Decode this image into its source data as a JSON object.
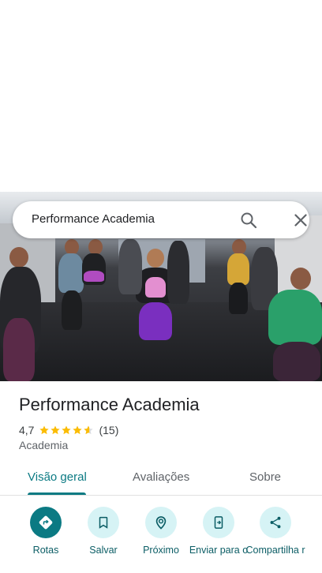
{
  "search": {
    "query": "Performance Academia"
  },
  "place": {
    "name": "Performance Academia",
    "rating": "4,7",
    "rating_stars": 4.7,
    "reviews_count": "(15)",
    "category": "Academia"
  },
  "tabs": [
    {
      "label": "Visão geral",
      "active": true
    },
    {
      "label": "Avaliações",
      "active": false
    },
    {
      "label": "Sobre",
      "active": false
    }
  ],
  "actions": [
    {
      "label": "Rotas",
      "icon": "directions-icon"
    },
    {
      "label": "Salvar",
      "icon": "bookmark-icon"
    },
    {
      "label": "Próximo",
      "icon": "nearby-icon"
    },
    {
      "label": "Enviar para o",
      "icon": "send-to-phone-icon"
    },
    {
      "label": "Compartilha r",
      "icon": "share-icon"
    }
  ],
  "colors": {
    "accent": "#0b7a83",
    "action_bg": "#d6f3f5",
    "star": "#fbbc04"
  }
}
